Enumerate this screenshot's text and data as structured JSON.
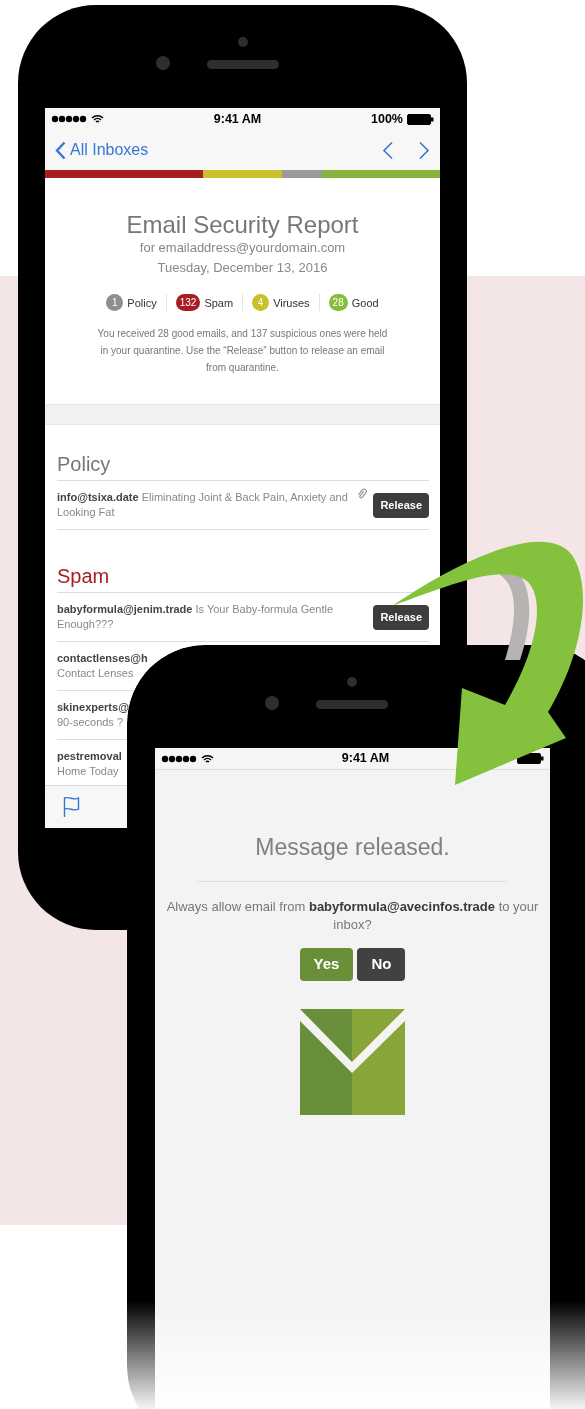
{
  "phone_1": {
    "status_bar": {
      "time": "9:41 AM",
      "battery": "100%"
    },
    "nav": {
      "back": "All Inboxes"
    },
    "report": {
      "title": "Email Security Report",
      "recipient": "for emailaddress@yourdomain.com",
      "date": "Tuesday, December 13, 2016",
      "counts": [
        {
          "count": "1",
          "label": "Policy",
          "color": "#8e8e8e"
        },
        {
          "count": "132",
          "label": "Spam",
          "color": "#a81d22"
        },
        {
          "count": "4",
          "label": "Viruses",
          "color": "#c8c22a"
        },
        {
          "count": "28",
          "label": "Good",
          "color": "#86bd3c"
        }
      ],
      "summary": "You received 28 good emails, and 137 suspicious ones were held in your quarantine. Use the “Release” button to release an email from quarantine."
    },
    "sections": [
      {
        "title": "Policy",
        "kind": "policy",
        "messages": [
          {
            "kind": "full",
            "sender": "info@tsixa.date",
            "subject": "Eliminating Joint & Back Pain, Anxiety and Looking Fat",
            "attachment": true,
            "action": "Release"
          }
        ]
      },
      {
        "title": "Spam",
        "kind": "spam",
        "messages": [
          {
            "kind": "full",
            "sender": "babyformula@jenim.trade",
            "subject": "Is Your Baby-formula Gentle Enough???",
            "attachment": false,
            "action": "Release"
          },
          {
            "kind": "clipped",
            "sender": "contactlenses@h",
            "subject": "Contact Lenses"
          },
          {
            "kind": "clipped",
            "sender": "skinexperts@",
            "subject": "90-seconds ?"
          },
          {
            "kind": "clipped",
            "sender": "pestremoval",
            "subject": "Home Today"
          }
        ]
      }
    ]
  },
  "phone_2": {
    "status_bar": {
      "time": "9:41 AM"
    },
    "dialog": {
      "title": "Message released.",
      "prompt": "Always allow email from **babyformula@avecinfos.trade** to your inbox?",
      "buttons": [
        {
          "label": "Yes",
          "kind": "confirm"
        },
        {
          "label": "No",
          "kind": "cancel"
        }
      ]
    }
  }
}
